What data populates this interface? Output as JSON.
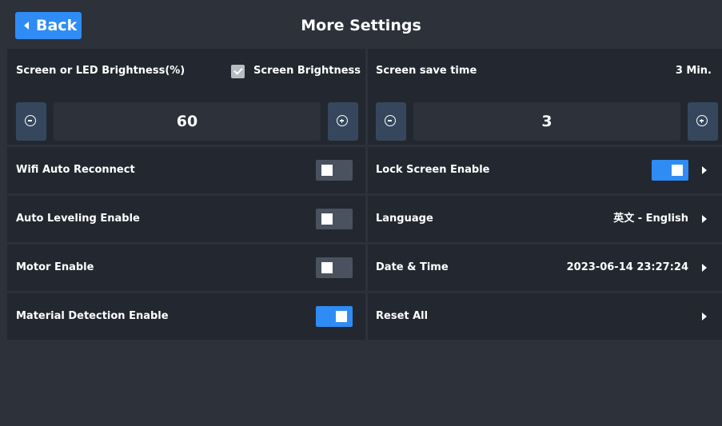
{
  "header": {
    "back_label": "Back",
    "title": "More Settings"
  },
  "brightness": {
    "label": "Screen or LED Brightness(%)",
    "checkbox_label": "Screen Brightness",
    "checkbox_checked": true,
    "value": "60"
  },
  "screen_save": {
    "label": "Screen save time",
    "display": "3 Min.",
    "value": "3"
  },
  "left_rows": [
    {
      "label": "Wifi Auto Reconnect",
      "enabled": false
    },
    {
      "label": "Auto Leveling Enable",
      "enabled": false
    },
    {
      "label": "Motor Enable",
      "enabled": false
    },
    {
      "label": "Material Detection Enable",
      "enabled": true
    }
  ],
  "right_rows": [
    {
      "label": "Lock Screen Enable",
      "enabled": true
    },
    {
      "label": "Language",
      "value": "英文 - English"
    },
    {
      "label": "Date & Time",
      "value": "2023-06-14 23:27:24"
    },
    {
      "label": "Reset All"
    }
  ],
  "colors": {
    "accent": "#2f8cf5",
    "background": "#2c313a",
    "panel": "#232830",
    "button": "#36475d"
  }
}
